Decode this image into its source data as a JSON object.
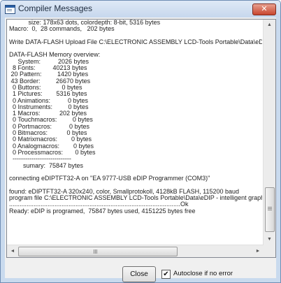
{
  "window": {
    "title": "Compiler Messages",
    "close_glyph": "✕"
  },
  "log": {
    "lines": [
      "           size: 178x63 dots, colordepth: 8-bit, 5316 bytes",
      "Macro:  0,  28 commands,   202 bytes",
      "",
      "Write DATA-FLASH Upload File C:\\ELECTRONIC ASSEMBLY LCD-Tools Portable\\Data\\eDIP - int",
      "",
      "DATA-FLASH Memory overview:",
      "     System:          2026 bytes",
      "  8 Fonts:          40213 bytes",
      " 20 Pattern:         1420 bytes",
      " 43 Border:         26670 bytes",
      "  0 Buttons:            0 bytes",
      "  1 Pictures:        5316 bytes",
      "  0 Animations:          0 bytes",
      "  0 Instruments:         0 bytes",
      "  1 Macros:           202 bytes",
      "  0 Touchmacros:         0 bytes",
      "  0 Portmacros:          0 bytes",
      "  0 Bitmacros:           0 bytes",
      "  0 Matrixmacros:        0 bytes",
      "  0 Analogmacros:        0 bytes",
      "  0 Processmacros:       0 bytes",
      "  ----------------------------",
      "        sumary:  75847 bytes",
      "",
      "connecting eDIPTFT32-A on \"EA 9777-USB eDIP Programmer (COM3)\"",
      "",
      "found: eDIPTFT32-A 320x240, color, Smallprotokoll, 4128kB FLASH, 115200 baud",
      "program file C:\\ELECTRONIC ASSEMBLY LCD-Tools Portable\\Data\\eDIP - intelligent graphic displ",
      "..................................................................................................Ok",
      "Ready: eDIP is programed,  75847 bytes used, 4151225 bytes free"
    ]
  },
  "vscroll": {
    "up": "▲",
    "down": "▼"
  },
  "hscroll": {
    "left": "◄",
    "right": "►",
    "grip": "III"
  },
  "footer": {
    "close_label": "Close",
    "autoclose_label": "Autoclose if no error",
    "autoclose_checked": "✔"
  }
}
